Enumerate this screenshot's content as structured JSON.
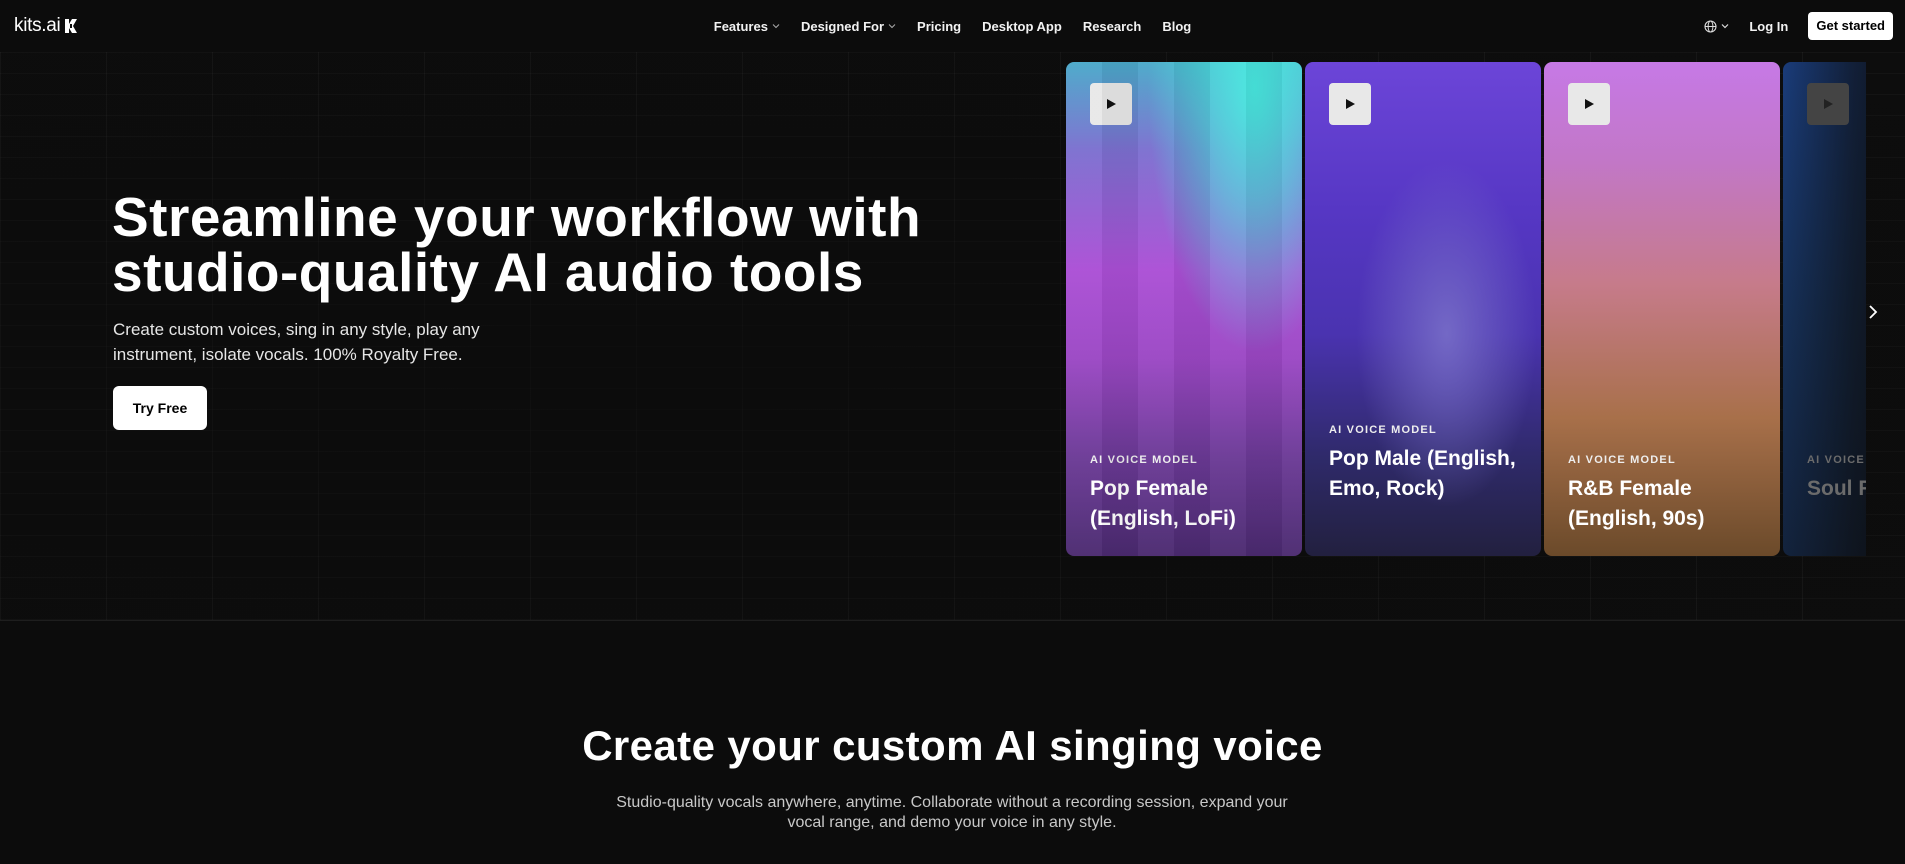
{
  "header": {
    "logo_text": "kits.ai",
    "nav": [
      {
        "label": "Features",
        "has_dropdown": true
      },
      {
        "label": "Designed For",
        "has_dropdown": true
      },
      {
        "label": "Pricing",
        "has_dropdown": false
      },
      {
        "label": "Desktop App",
        "has_dropdown": false
      },
      {
        "label": "Research",
        "has_dropdown": false
      },
      {
        "label": "Blog",
        "has_dropdown": false
      }
    ],
    "language_icon": "globe-icon",
    "login_label": "Log In",
    "cta_label": "Get started"
  },
  "hero": {
    "title": "Streamline your workflow with studio-quality AI audio tools",
    "subtitle": "Create custom voices, sing in any style, play any instrument, isolate vocals. 100% Royalty Free.",
    "cta_label": "Try Free"
  },
  "cards": [
    {
      "label": "AI VOICE MODEL",
      "name": "Pop Female (English, LoFi)"
    },
    {
      "label": "AI VOICE MODEL",
      "name": "Pop Male (English, Emo, Rock)"
    },
    {
      "label": "AI VOICE MODEL",
      "name": "R&B Female (English, 90s)"
    },
    {
      "label": "AI VOICE MODEL",
      "name": "Soul F... (Engli..."
    }
  ],
  "section": {
    "title": "Create your custom AI singing voice",
    "subtitle": "Studio-quality vocals anywhere, anytime. Collaborate without a recording session, expand your vocal range, and demo your voice in any style."
  },
  "colors": {
    "background": "#0c0c0c",
    "primary_button_bg": "#ffffff",
    "primary_button_text": "#000000"
  }
}
